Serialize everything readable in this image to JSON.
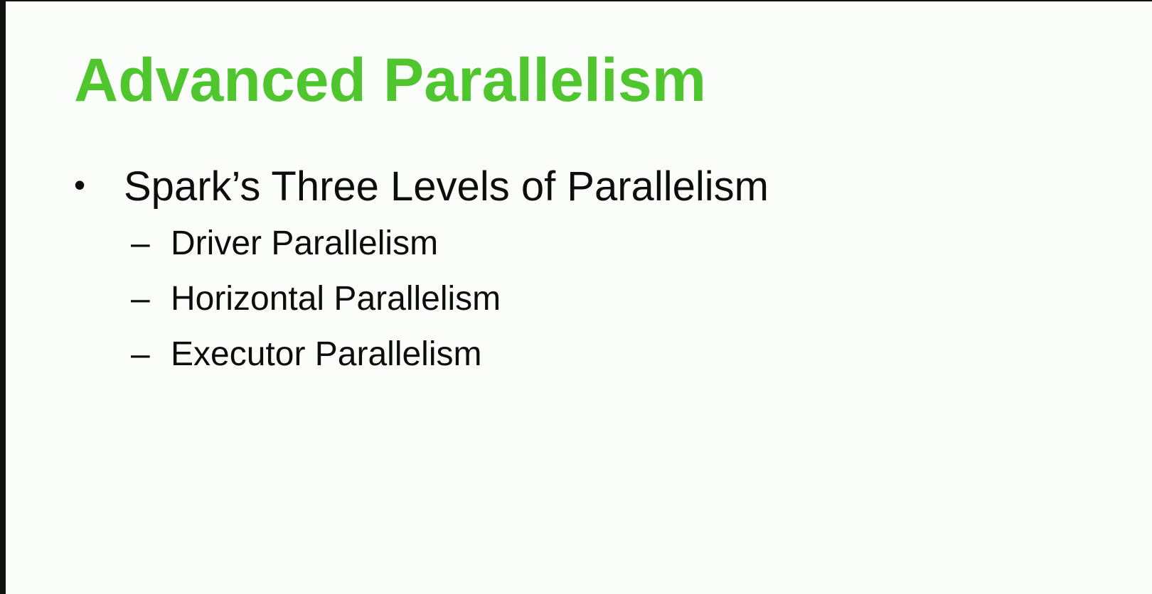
{
  "slide": {
    "title": "Advanced Parallelism",
    "title_color": "#4fc52e",
    "main_bullet": {
      "marker": "•",
      "text": "Spark’s Three Levels of Parallelism"
    },
    "sub_bullets": [
      {
        "marker": "–",
        "text": "Driver Parallelism"
      },
      {
        "marker": "–",
        "text": "Horizontal Parallelism"
      },
      {
        "marker": "–",
        "text": "Executor Parallelism"
      }
    ]
  }
}
